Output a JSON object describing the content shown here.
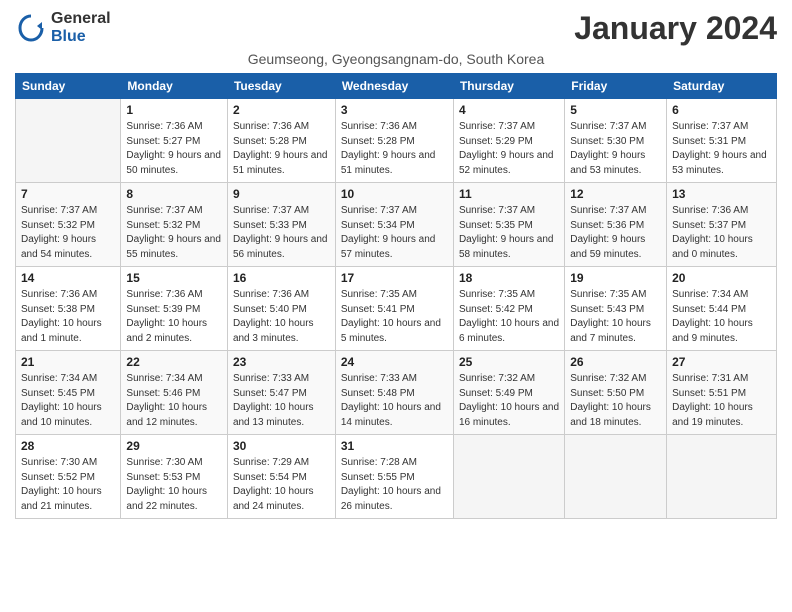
{
  "header": {
    "logo_general": "General",
    "logo_blue": "Blue",
    "month_title": "January 2024",
    "subtitle": "Geumseong, Gyeongsangnam-do, South Korea"
  },
  "weekdays": [
    "Sunday",
    "Monday",
    "Tuesday",
    "Wednesday",
    "Thursday",
    "Friday",
    "Saturday"
  ],
  "weeks": [
    [
      {
        "num": "",
        "sunrise": "",
        "sunset": "",
        "daylight": "",
        "empty": true
      },
      {
        "num": "1",
        "sunrise": "Sunrise: 7:36 AM",
        "sunset": "Sunset: 5:27 PM",
        "daylight": "Daylight: 9 hours and 50 minutes.",
        "empty": false
      },
      {
        "num": "2",
        "sunrise": "Sunrise: 7:36 AM",
        "sunset": "Sunset: 5:28 PM",
        "daylight": "Daylight: 9 hours and 51 minutes.",
        "empty": false
      },
      {
        "num": "3",
        "sunrise": "Sunrise: 7:36 AM",
        "sunset": "Sunset: 5:28 PM",
        "daylight": "Daylight: 9 hours and 51 minutes.",
        "empty": false
      },
      {
        "num": "4",
        "sunrise": "Sunrise: 7:37 AM",
        "sunset": "Sunset: 5:29 PM",
        "daylight": "Daylight: 9 hours and 52 minutes.",
        "empty": false
      },
      {
        "num": "5",
        "sunrise": "Sunrise: 7:37 AM",
        "sunset": "Sunset: 5:30 PM",
        "daylight": "Daylight: 9 hours and 53 minutes.",
        "empty": false
      },
      {
        "num": "6",
        "sunrise": "Sunrise: 7:37 AM",
        "sunset": "Sunset: 5:31 PM",
        "daylight": "Daylight: 9 hours and 53 minutes.",
        "empty": false
      }
    ],
    [
      {
        "num": "7",
        "sunrise": "Sunrise: 7:37 AM",
        "sunset": "Sunset: 5:32 PM",
        "daylight": "Daylight: 9 hours and 54 minutes.",
        "empty": false
      },
      {
        "num": "8",
        "sunrise": "Sunrise: 7:37 AM",
        "sunset": "Sunset: 5:32 PM",
        "daylight": "Daylight: 9 hours and 55 minutes.",
        "empty": false
      },
      {
        "num": "9",
        "sunrise": "Sunrise: 7:37 AM",
        "sunset": "Sunset: 5:33 PM",
        "daylight": "Daylight: 9 hours and 56 minutes.",
        "empty": false
      },
      {
        "num": "10",
        "sunrise": "Sunrise: 7:37 AM",
        "sunset": "Sunset: 5:34 PM",
        "daylight": "Daylight: 9 hours and 57 minutes.",
        "empty": false
      },
      {
        "num": "11",
        "sunrise": "Sunrise: 7:37 AM",
        "sunset": "Sunset: 5:35 PM",
        "daylight": "Daylight: 9 hours and 58 minutes.",
        "empty": false
      },
      {
        "num": "12",
        "sunrise": "Sunrise: 7:37 AM",
        "sunset": "Sunset: 5:36 PM",
        "daylight": "Daylight: 9 hours and 59 minutes.",
        "empty": false
      },
      {
        "num": "13",
        "sunrise": "Sunrise: 7:36 AM",
        "sunset": "Sunset: 5:37 PM",
        "daylight": "Daylight: 10 hours and 0 minutes.",
        "empty": false
      }
    ],
    [
      {
        "num": "14",
        "sunrise": "Sunrise: 7:36 AM",
        "sunset": "Sunset: 5:38 PM",
        "daylight": "Daylight: 10 hours and 1 minute.",
        "empty": false
      },
      {
        "num": "15",
        "sunrise": "Sunrise: 7:36 AM",
        "sunset": "Sunset: 5:39 PM",
        "daylight": "Daylight: 10 hours and 2 minutes.",
        "empty": false
      },
      {
        "num": "16",
        "sunrise": "Sunrise: 7:36 AM",
        "sunset": "Sunset: 5:40 PM",
        "daylight": "Daylight: 10 hours and 3 minutes.",
        "empty": false
      },
      {
        "num": "17",
        "sunrise": "Sunrise: 7:35 AM",
        "sunset": "Sunset: 5:41 PM",
        "daylight": "Daylight: 10 hours and 5 minutes.",
        "empty": false
      },
      {
        "num": "18",
        "sunrise": "Sunrise: 7:35 AM",
        "sunset": "Sunset: 5:42 PM",
        "daylight": "Daylight: 10 hours and 6 minutes.",
        "empty": false
      },
      {
        "num": "19",
        "sunrise": "Sunrise: 7:35 AM",
        "sunset": "Sunset: 5:43 PM",
        "daylight": "Daylight: 10 hours and 7 minutes.",
        "empty": false
      },
      {
        "num": "20",
        "sunrise": "Sunrise: 7:34 AM",
        "sunset": "Sunset: 5:44 PM",
        "daylight": "Daylight: 10 hours and 9 minutes.",
        "empty": false
      }
    ],
    [
      {
        "num": "21",
        "sunrise": "Sunrise: 7:34 AM",
        "sunset": "Sunset: 5:45 PM",
        "daylight": "Daylight: 10 hours and 10 minutes.",
        "empty": false
      },
      {
        "num": "22",
        "sunrise": "Sunrise: 7:34 AM",
        "sunset": "Sunset: 5:46 PM",
        "daylight": "Daylight: 10 hours and 12 minutes.",
        "empty": false
      },
      {
        "num": "23",
        "sunrise": "Sunrise: 7:33 AM",
        "sunset": "Sunset: 5:47 PM",
        "daylight": "Daylight: 10 hours and 13 minutes.",
        "empty": false
      },
      {
        "num": "24",
        "sunrise": "Sunrise: 7:33 AM",
        "sunset": "Sunset: 5:48 PM",
        "daylight": "Daylight: 10 hours and 14 minutes.",
        "empty": false
      },
      {
        "num": "25",
        "sunrise": "Sunrise: 7:32 AM",
        "sunset": "Sunset: 5:49 PM",
        "daylight": "Daylight: 10 hours and 16 minutes.",
        "empty": false
      },
      {
        "num": "26",
        "sunrise": "Sunrise: 7:32 AM",
        "sunset": "Sunset: 5:50 PM",
        "daylight": "Daylight: 10 hours and 18 minutes.",
        "empty": false
      },
      {
        "num": "27",
        "sunrise": "Sunrise: 7:31 AM",
        "sunset": "Sunset: 5:51 PM",
        "daylight": "Daylight: 10 hours and 19 minutes.",
        "empty": false
      }
    ],
    [
      {
        "num": "28",
        "sunrise": "Sunrise: 7:30 AM",
        "sunset": "Sunset: 5:52 PM",
        "daylight": "Daylight: 10 hours and 21 minutes.",
        "empty": false
      },
      {
        "num": "29",
        "sunrise": "Sunrise: 7:30 AM",
        "sunset": "Sunset: 5:53 PM",
        "daylight": "Daylight: 10 hours and 22 minutes.",
        "empty": false
      },
      {
        "num": "30",
        "sunrise": "Sunrise: 7:29 AM",
        "sunset": "Sunset: 5:54 PM",
        "daylight": "Daylight: 10 hours and 24 minutes.",
        "empty": false
      },
      {
        "num": "31",
        "sunrise": "Sunrise: 7:28 AM",
        "sunset": "Sunset: 5:55 PM",
        "daylight": "Daylight: 10 hours and 26 minutes.",
        "empty": false
      },
      {
        "num": "",
        "sunrise": "",
        "sunset": "",
        "daylight": "",
        "empty": true
      },
      {
        "num": "",
        "sunrise": "",
        "sunset": "",
        "daylight": "",
        "empty": true
      },
      {
        "num": "",
        "sunrise": "",
        "sunset": "",
        "daylight": "",
        "empty": true
      }
    ]
  ]
}
